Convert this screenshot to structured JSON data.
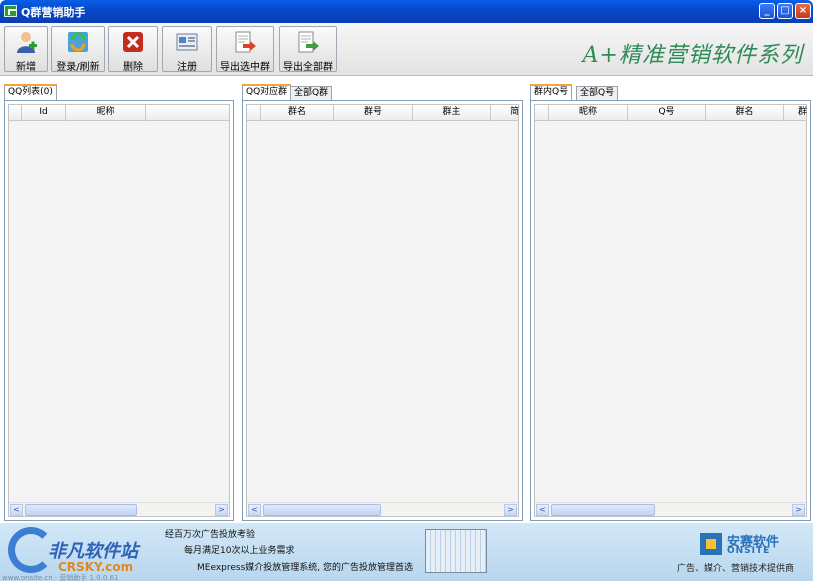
{
  "window": {
    "title": "Q群营销助手",
    "controls": [
      "minimize-icon",
      "maximize-icon",
      "close-icon"
    ]
  },
  "toolbar": {
    "buttons": [
      {
        "label": "新增",
        "icon": "add-user-icon"
      },
      {
        "label": "登录/刷新",
        "icon": "refresh-icon"
      },
      {
        "label": "删除",
        "icon": "delete-icon"
      },
      {
        "label": "注册",
        "icon": "register-icon"
      },
      {
        "label": "导出选中群",
        "icon": "export-selected-icon"
      },
      {
        "label": "导出全部群",
        "icon": "export-all-icon"
      }
    ],
    "brand": "A+精准营销软件系列"
  },
  "left_panel": {
    "tabs": [
      "QQ列表(0)"
    ],
    "columns": [
      "",
      "Id",
      "昵称",
      ""
    ]
  },
  "middle_panel": {
    "tabs": [
      "QQ对应群",
      "全部Q群"
    ],
    "columns": [
      "",
      "群名",
      "群号",
      "群主",
      "简"
    ]
  },
  "right_panel": {
    "tabs": [
      "群内Q号",
      "全部Q号"
    ],
    "columns": [
      "",
      "昵称",
      "Q号",
      "群名",
      "群"
    ]
  },
  "scrollbar": {
    "left_arrow": "<",
    "right_arrow": ">",
    "grip": "|||"
  },
  "footer": {
    "site_name": "非凡软件站",
    "site_domain": "CRSKY.com",
    "watermark": "www.onsite.cn  ·  营销助手  1.0.0.61",
    "ad_lines": [
      "经百万次广告投放考验",
      "每月满足10次以上业务需求",
      "MEexpress媒介投放管理系统, 您的广告投放管理首选"
    ],
    "company_cn": "安赛软件",
    "company_en": "ONSITE",
    "company_tag": "广告、媒介、营销技术提供商"
  }
}
